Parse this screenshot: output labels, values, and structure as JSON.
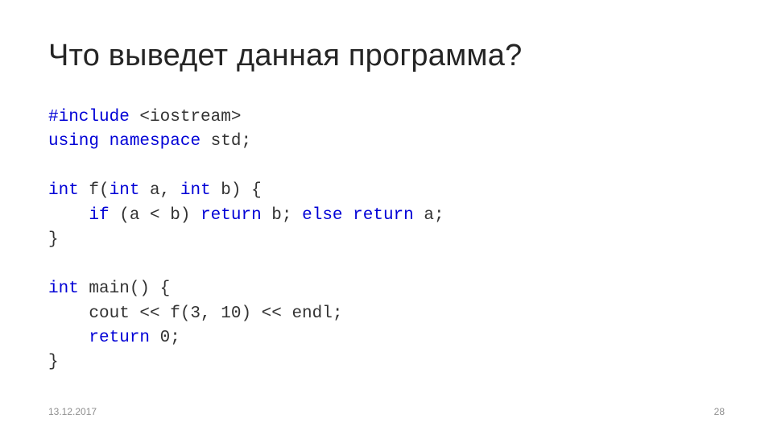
{
  "title": "Что выведет данная программа?",
  "code": {
    "l1": {
      "a": "#include",
      "b": " <iostream>"
    },
    "l2": {
      "a": "using",
      "b": " ",
      "c": "namespace",
      "d": " std;"
    },
    "l3": "",
    "l4": {
      "a": "int",
      "b": " f(",
      "c": "int",
      "d": " a, ",
      "e": "int",
      "f": " b) {"
    },
    "l5": {
      "a": "    ",
      "b": "if",
      "c": " (a < b) ",
      "d": "return",
      "e": " b; ",
      "f": "else",
      "g": " ",
      "h": "return",
      "i": " a;"
    },
    "l6": "}",
    "l7": "",
    "l8": {
      "a": "int",
      "b": " main() {"
    },
    "l9": {
      "a": "    cout << f(3, 10) << endl;"
    },
    "l10": {
      "a": "    ",
      "b": "return",
      "c": " 0;"
    },
    "l11": "}"
  },
  "footer": {
    "date": "13.12.2017",
    "page": "28"
  }
}
